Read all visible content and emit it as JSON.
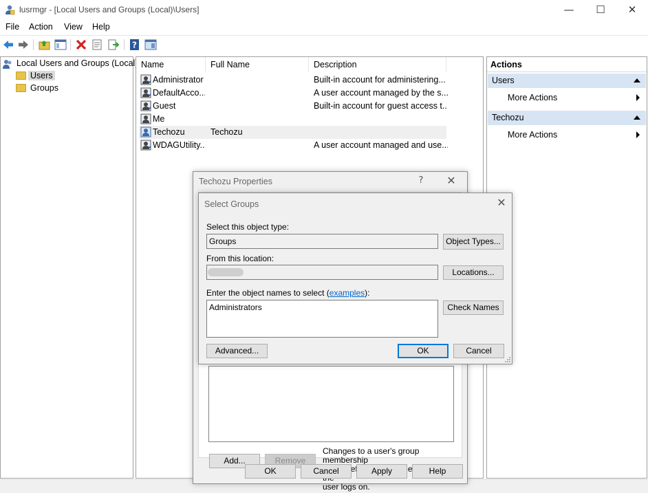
{
  "window": {
    "title": "lusrmgr - [Local Users and Groups (Local)\\Users]",
    "minimize_glyph": "—",
    "maximize_glyph": "☐",
    "close_glyph": "✕"
  },
  "menu": [
    "File",
    "Action",
    "View",
    "Help"
  ],
  "toolbar_icons": [
    "back-icon",
    "forward-icon",
    "up-folder-icon",
    "show-hide-tree-icon",
    "delete-icon",
    "properties-icon",
    "export-list-icon",
    "help-icon",
    "show-action-pane-icon"
  ],
  "tree": {
    "root": "Local Users and Groups (Local)",
    "children": [
      "Users",
      "Groups"
    ],
    "selected": "Users"
  },
  "list": {
    "columns": [
      "Name",
      "Full Name",
      "Description"
    ],
    "rows": [
      {
        "name": "Administrator",
        "full_name": "",
        "description": "Built-in account for administering..."
      },
      {
        "name": "DefaultAcco...",
        "full_name": "",
        "description": "A user account managed by the s..."
      },
      {
        "name": "Guest",
        "full_name": "",
        "description": "Built-in account for guest access t..."
      },
      {
        "name": "Me",
        "full_name": "",
        "description": ""
      },
      {
        "name": "Techozu",
        "full_name": "Techozu",
        "description": ""
      },
      {
        "name": "WDAGUtility...",
        "full_name": "",
        "description": "A user account managed and use..."
      }
    ],
    "selected_row": 4
  },
  "actions": {
    "title": "Actions",
    "sections": [
      {
        "header": "Users",
        "item": "More Actions"
      },
      {
        "header": "Techozu",
        "item": "More Actions"
      }
    ]
  },
  "properties_dialog": {
    "title": "Techozu Properties",
    "help_glyph": "?",
    "close_glyph": "✕",
    "add_label": "Add...",
    "remove_label": "Remove",
    "note": [
      "Changes to a user's group membership",
      "are not effective until the next time the",
      "user logs on."
    ],
    "ok_label": "OK",
    "cancel_label": "Cancel",
    "apply_label": "Apply",
    "help_label": "Help"
  },
  "select_groups_dialog": {
    "title": "Select Groups",
    "close_glyph": "✕",
    "object_type_label": "Select this object type:",
    "object_type_value": "Groups",
    "object_types_button": "Object Types...",
    "location_label": "From this location:",
    "locations_button": "Locations...",
    "names_label_prefix": "Enter the object names to select (",
    "names_label_link": "examples",
    "names_label_suffix": "):",
    "names_value": "Administrators",
    "check_names_button": "Check Names",
    "advanced_button": "Advanced...",
    "ok_label": "OK",
    "cancel_label": "Cancel"
  }
}
